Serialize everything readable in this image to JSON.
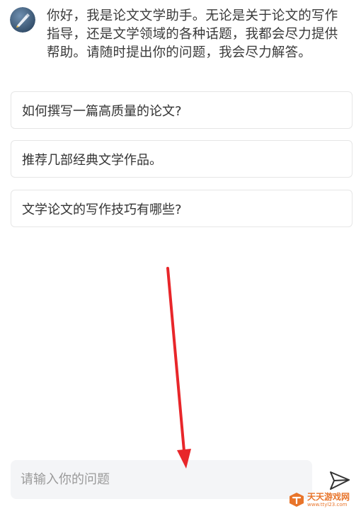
{
  "assistant": {
    "greeting": "你好，我是论文文学助手。无论是关于论文的写作指导，还是文学领域的各种话题，我都会尽力提供帮助。请随时提出你的问题，我会尽力解答。"
  },
  "suggestions": [
    {
      "label": "如何撰写一篇高质量的论文?"
    },
    {
      "label": "推荐几部经典文学作品。"
    },
    {
      "label": "文学论文的写作技巧有哪些?"
    }
  ],
  "input": {
    "value": "",
    "placeholder": "请输入你的问题"
  },
  "watermark": {
    "title": "天天游戏网",
    "url": "www.ttyl23.com"
  },
  "colors": {
    "annotation_arrow": "#e8262a",
    "avatar_bg": "#4a6a8c",
    "input_bg": "#f4f5f7",
    "watermark": "#e8742a"
  }
}
